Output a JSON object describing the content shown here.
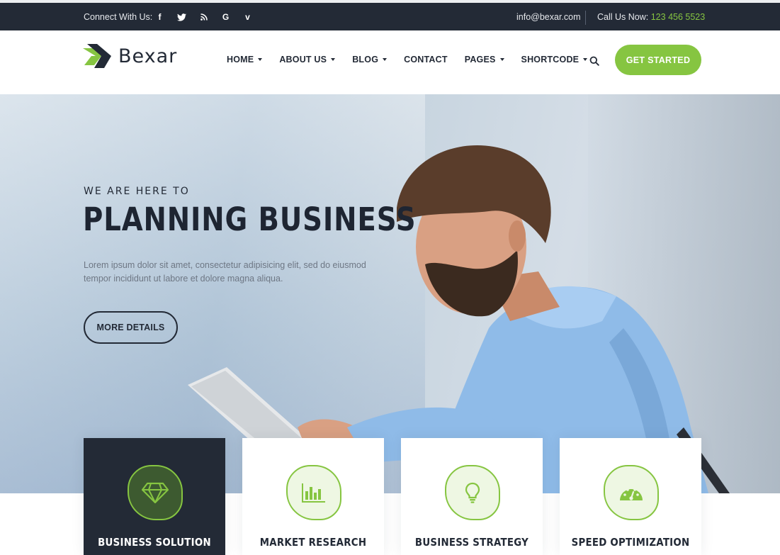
{
  "topbar": {
    "connect_label": "Connect With Us:",
    "socials": [
      {
        "icon": "facebook-icon",
        "glyph": "f"
      },
      {
        "icon": "twitter-icon",
        "glyph": "🐦"
      },
      {
        "icon": "rss-icon",
        "glyph": "◥"
      },
      {
        "icon": "google-icon",
        "glyph": "G"
      },
      {
        "icon": "vimeo-icon",
        "glyph": "v"
      }
    ],
    "email": "info@bexar.com",
    "call_label": "Call Us Now:",
    "call_number": "123 456 5523"
  },
  "header": {
    "brand": "Bexar",
    "nav": [
      {
        "label": "HOME",
        "dropdown": true
      },
      {
        "label": "ABOUT US",
        "dropdown": true
      },
      {
        "label": "BLOG",
        "dropdown": true
      },
      {
        "label": "CONTACT",
        "dropdown": false
      },
      {
        "label": "PAGES",
        "dropdown": true
      },
      {
        "label": "SHORTCODE",
        "dropdown": true
      }
    ],
    "cta_label": "GET STARTED"
  },
  "hero": {
    "kicker": "WE ARE HERE TO",
    "headline": "PLANNING BUSINESS",
    "lead": "Lorem ipsum dolor sit amet, consectetur adipisicing elit, sed do eiusmod tempor incididunt ut labore et dolore magna aliqua.",
    "button_label": "MORE DETAILS"
  },
  "features": [
    {
      "title": "BUSINESS SOLUTION",
      "icon": "diamond-icon",
      "active": true
    },
    {
      "title": "MARKET RESEARCH",
      "icon": "bar-chart-icon",
      "active": false
    },
    {
      "title": "BUSINESS STRATEGY",
      "icon": "lightbulb-icon",
      "active": false
    },
    {
      "title": "SPEED OPTIMIZATION",
      "icon": "speedometer-icon",
      "active": false
    }
  ],
  "colors": {
    "accent": "#86c541",
    "dark": "#232a36",
    "text_muted": "#6e7784"
  }
}
